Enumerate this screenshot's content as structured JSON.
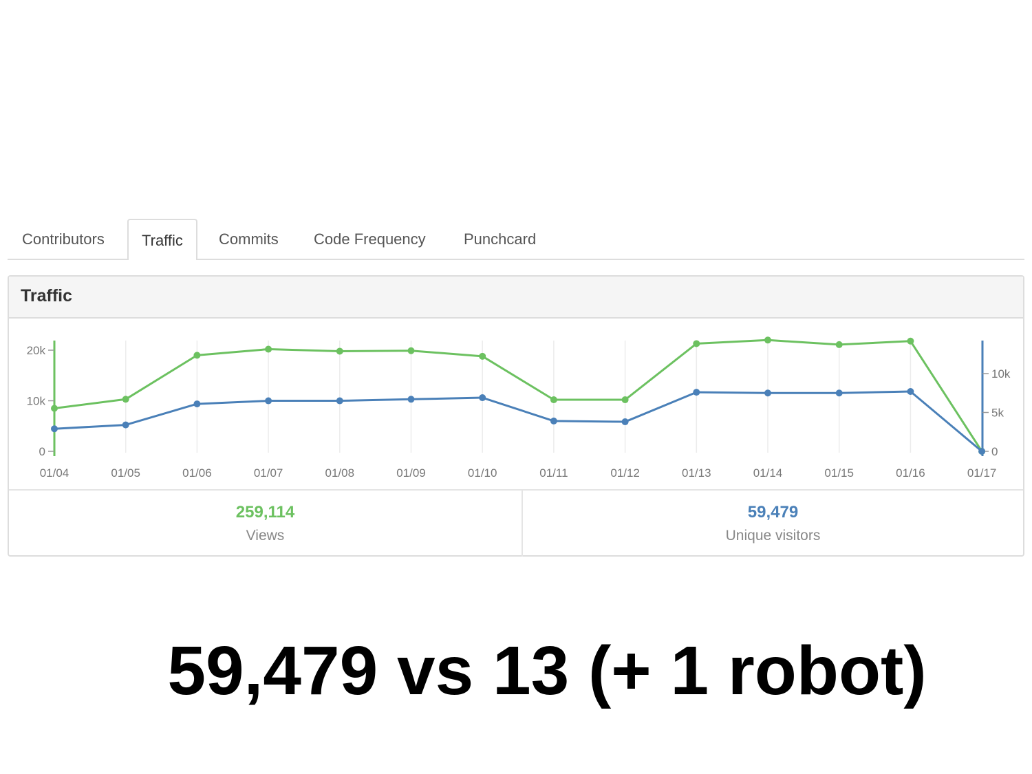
{
  "tabs": [
    {
      "label": "Contributors",
      "active": false
    },
    {
      "label": "Traffic",
      "active": true
    },
    {
      "label": "Commits",
      "active": false
    },
    {
      "label": "Code Frequency",
      "active": false
    },
    {
      "label": "Punchcard",
      "active": false
    }
  ],
  "panel": {
    "title": "Traffic"
  },
  "summary": {
    "views": {
      "value": "259,114",
      "label": "Views"
    },
    "visitors": {
      "value": "59,479",
      "label": "Unique visitors"
    }
  },
  "caption": "59,479 vs 13 (+ 1 robot)",
  "colors": {
    "views": "#6cc160",
    "visitors": "#4a80b8"
  },
  "chart_data": {
    "type": "line",
    "categories": [
      "01/04",
      "01/05",
      "01/06",
      "01/07",
      "01/08",
      "01/09",
      "01/10",
      "01/11",
      "01/12",
      "01/13",
      "01/14",
      "01/15",
      "01/16",
      "01/17"
    ],
    "series": [
      {
        "axis": "left",
        "color": "#6cc160",
        "values": [
          8500,
          10300,
          19000,
          20200,
          19800,
          19900,
          18800,
          10200,
          10200,
          21300,
          22000,
          21100,
          21800,
          0
        ]
      },
      {
        "axis": "right",
        "color": "#4a80b8",
        "values": [
          2900,
          3400,
          6100,
          6500,
          6500,
          6700,
          6900,
          3900,
          3800,
          7600,
          7500,
          7500,
          7700,
          0
        ]
      }
    ],
    "y_left": {
      "ticks": [
        0,
        10000,
        20000
      ],
      "tick_labels": [
        "0",
        "10k",
        "20k"
      ],
      "range": [
        0,
        22500
      ]
    },
    "y_right": {
      "ticks": [
        0,
        5000,
        10000
      ],
      "tick_labels": [
        "0",
        "5k",
        "10k"
      ],
      "range": [
        0,
        14500
      ]
    },
    "grid": "vertical"
  }
}
